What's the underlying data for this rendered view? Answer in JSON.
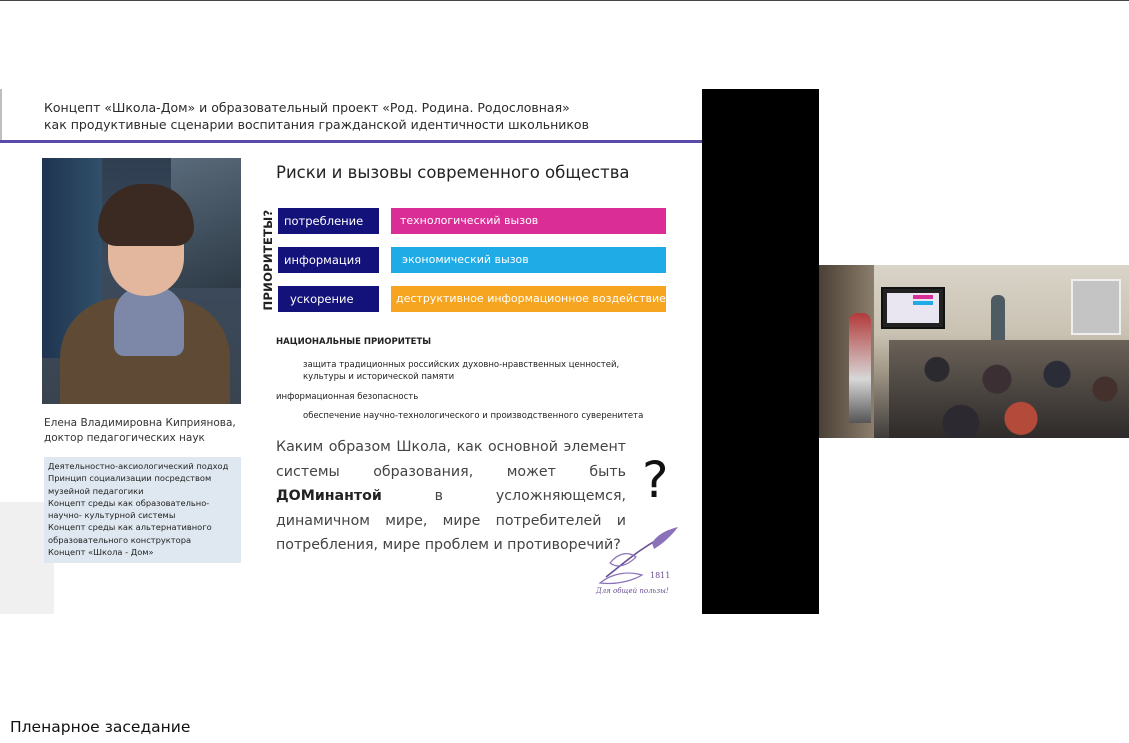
{
  "caption": "Пленарное заседание",
  "slide": {
    "title_line1": "Концепт «Школа-Дом» и образовательный проект «Род. Родина. Родословная»",
    "title_line2": "как продуктивные сценарии воспитания гражданской идентичности школьников",
    "speaker_name": "Елена Владимировна Киприянова,",
    "speaker_degree": "доктор педагогических наук",
    "concepts": [
      "Деятельностно-аксиологический  подход",
      "Принцип социализации  посредством",
      "музейной педагогики",
      "Концепт среды как образовательно-",
      "научно- культурной  системы",
      "Концепт среды как альтернативного",
      "образовательного конструктора",
      "Концепт «Школа - Дом»"
    ],
    "risks_title": "Риски и вызовы современного общества",
    "priorities_vertical": "ПРИОРИТЕТЫ?",
    "rows": [
      {
        "left": "потребление",
        "right": "технологический вызов",
        "color": "#da2d96"
      },
      {
        "left": "информация",
        "right": "экономический вызов",
        "color": "#1eabe6"
      },
      {
        "left": "ускорение",
        "right": "деструктивное информационное воздействие",
        "color": "#f6a520"
      }
    ],
    "national_priorities_title": "НАЦИОНАЛЬНЫЕ ПРИОРИТЕТЫ",
    "np_line1": "защита  традиционных  российских  духовно-нравственных  ценностей,",
    "np_line2": "культуры и исторической памяти",
    "np_line3": "информационная безопасность",
    "np_line4": "обеспечение научно-технологического и производственного суверенитета",
    "question_part1": "Каким образом Школа, как основной элемент системы образования, может быть ",
    "question_bold": "ДОМинантой",
    "question_part2": " в усложняющемся, динамичном мире, мире потребителей и потребления, мире проблем и противоречий?",
    "question_mark": "?",
    "logo_year": "1811",
    "logo_motto": "Для общей пользы!"
  },
  "colors": {
    "navy": "#13127a",
    "accent_rule": "#5b4aa8"
  }
}
